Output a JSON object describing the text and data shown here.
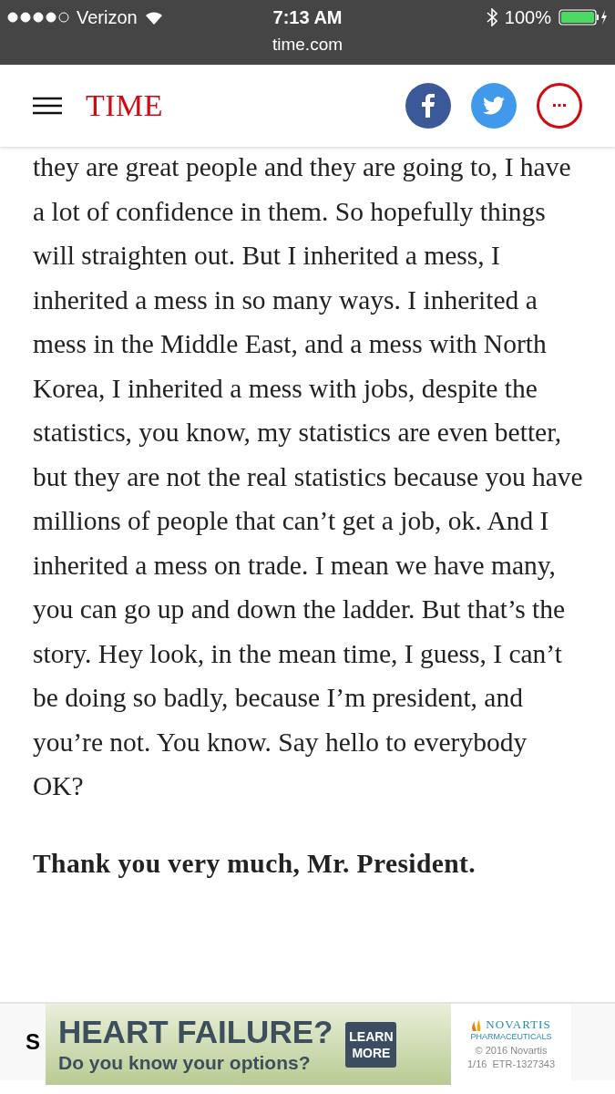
{
  "status_bar": {
    "carrier": "Verizon",
    "time": "7:13 AM",
    "battery": "100%",
    "url": "time.com"
  },
  "header": {
    "logo": "TIME"
  },
  "article": {
    "paragraphs": [
      {
        "kind": "plain",
        "text": "they are great people and they are going to, I have a lot of confidence in them. So hopefully things will straighten out. But I inherited a mess, I inherited a mess in so many ways. I inherited a mess in the Middle East, and a mess with North Korea, I inherited a mess with jobs, despite the statistics, you know, my statistics are even better, but they are not the real statistics because you have millions of people that can’t get a job, ok. And I inherited a mess on trade. I mean we have many, you can go up and down the ladder. But that’s the story. Hey look, in the mean time, I guess, I can’t be doing so badly, because I’m president, and you’re not. You know. Say hello to everybody OK?"
      },
      {
        "kind": "bold",
        "text": "Thank you very much, Mr. President."
      }
    ]
  },
  "bottom_bar": {
    "label": "S"
  },
  "ad": {
    "headline": "HEART FAILURE?",
    "subline": "Do you know your options?",
    "button": "LEARN MORE",
    "brand": "NOVARTIS",
    "brand_sub": "PHARMACEUTICALS",
    "copyright": "© 2016 Novartis",
    "code": "1/16  ETR-1327343"
  }
}
